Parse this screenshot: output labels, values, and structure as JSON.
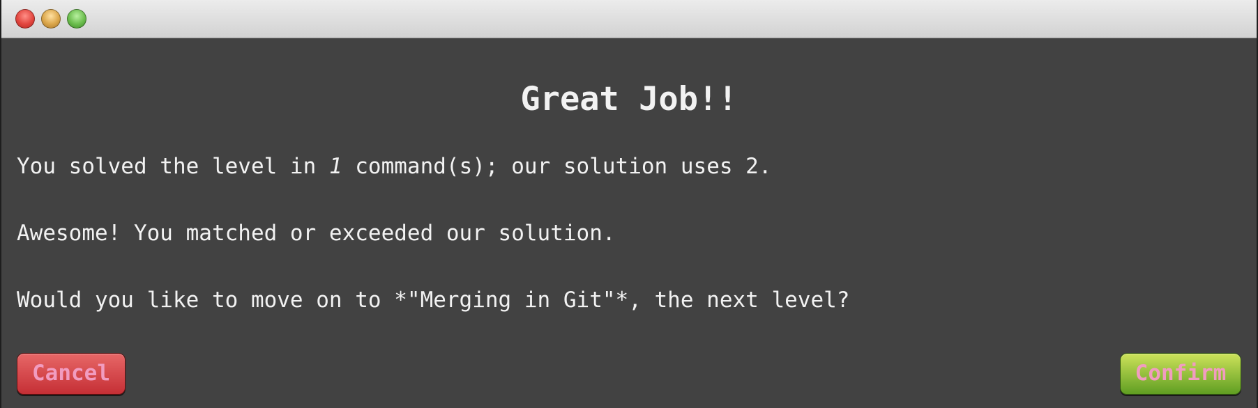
{
  "window": {
    "controls": [
      "close",
      "minimize",
      "zoom"
    ]
  },
  "dialog": {
    "title": "Great Job!!",
    "line1_prefix": "You solved the level in ",
    "line1_count": "1",
    "line1_suffix": " command(s); our solution uses 2.",
    "line2": "Awesome! You matched or exceeded our solution.",
    "line3": "Would you like to move on to *\"Merging in Git\"*, the next level?"
  },
  "buttons": {
    "cancel_label": "Cancel",
    "confirm_label": "Confirm"
  },
  "colors": {
    "background": "#424242",
    "text": "#f2f2f2",
    "button_text": "#f19cc0",
    "cancel": "#d64545",
    "confirm": "#8dc03a"
  }
}
